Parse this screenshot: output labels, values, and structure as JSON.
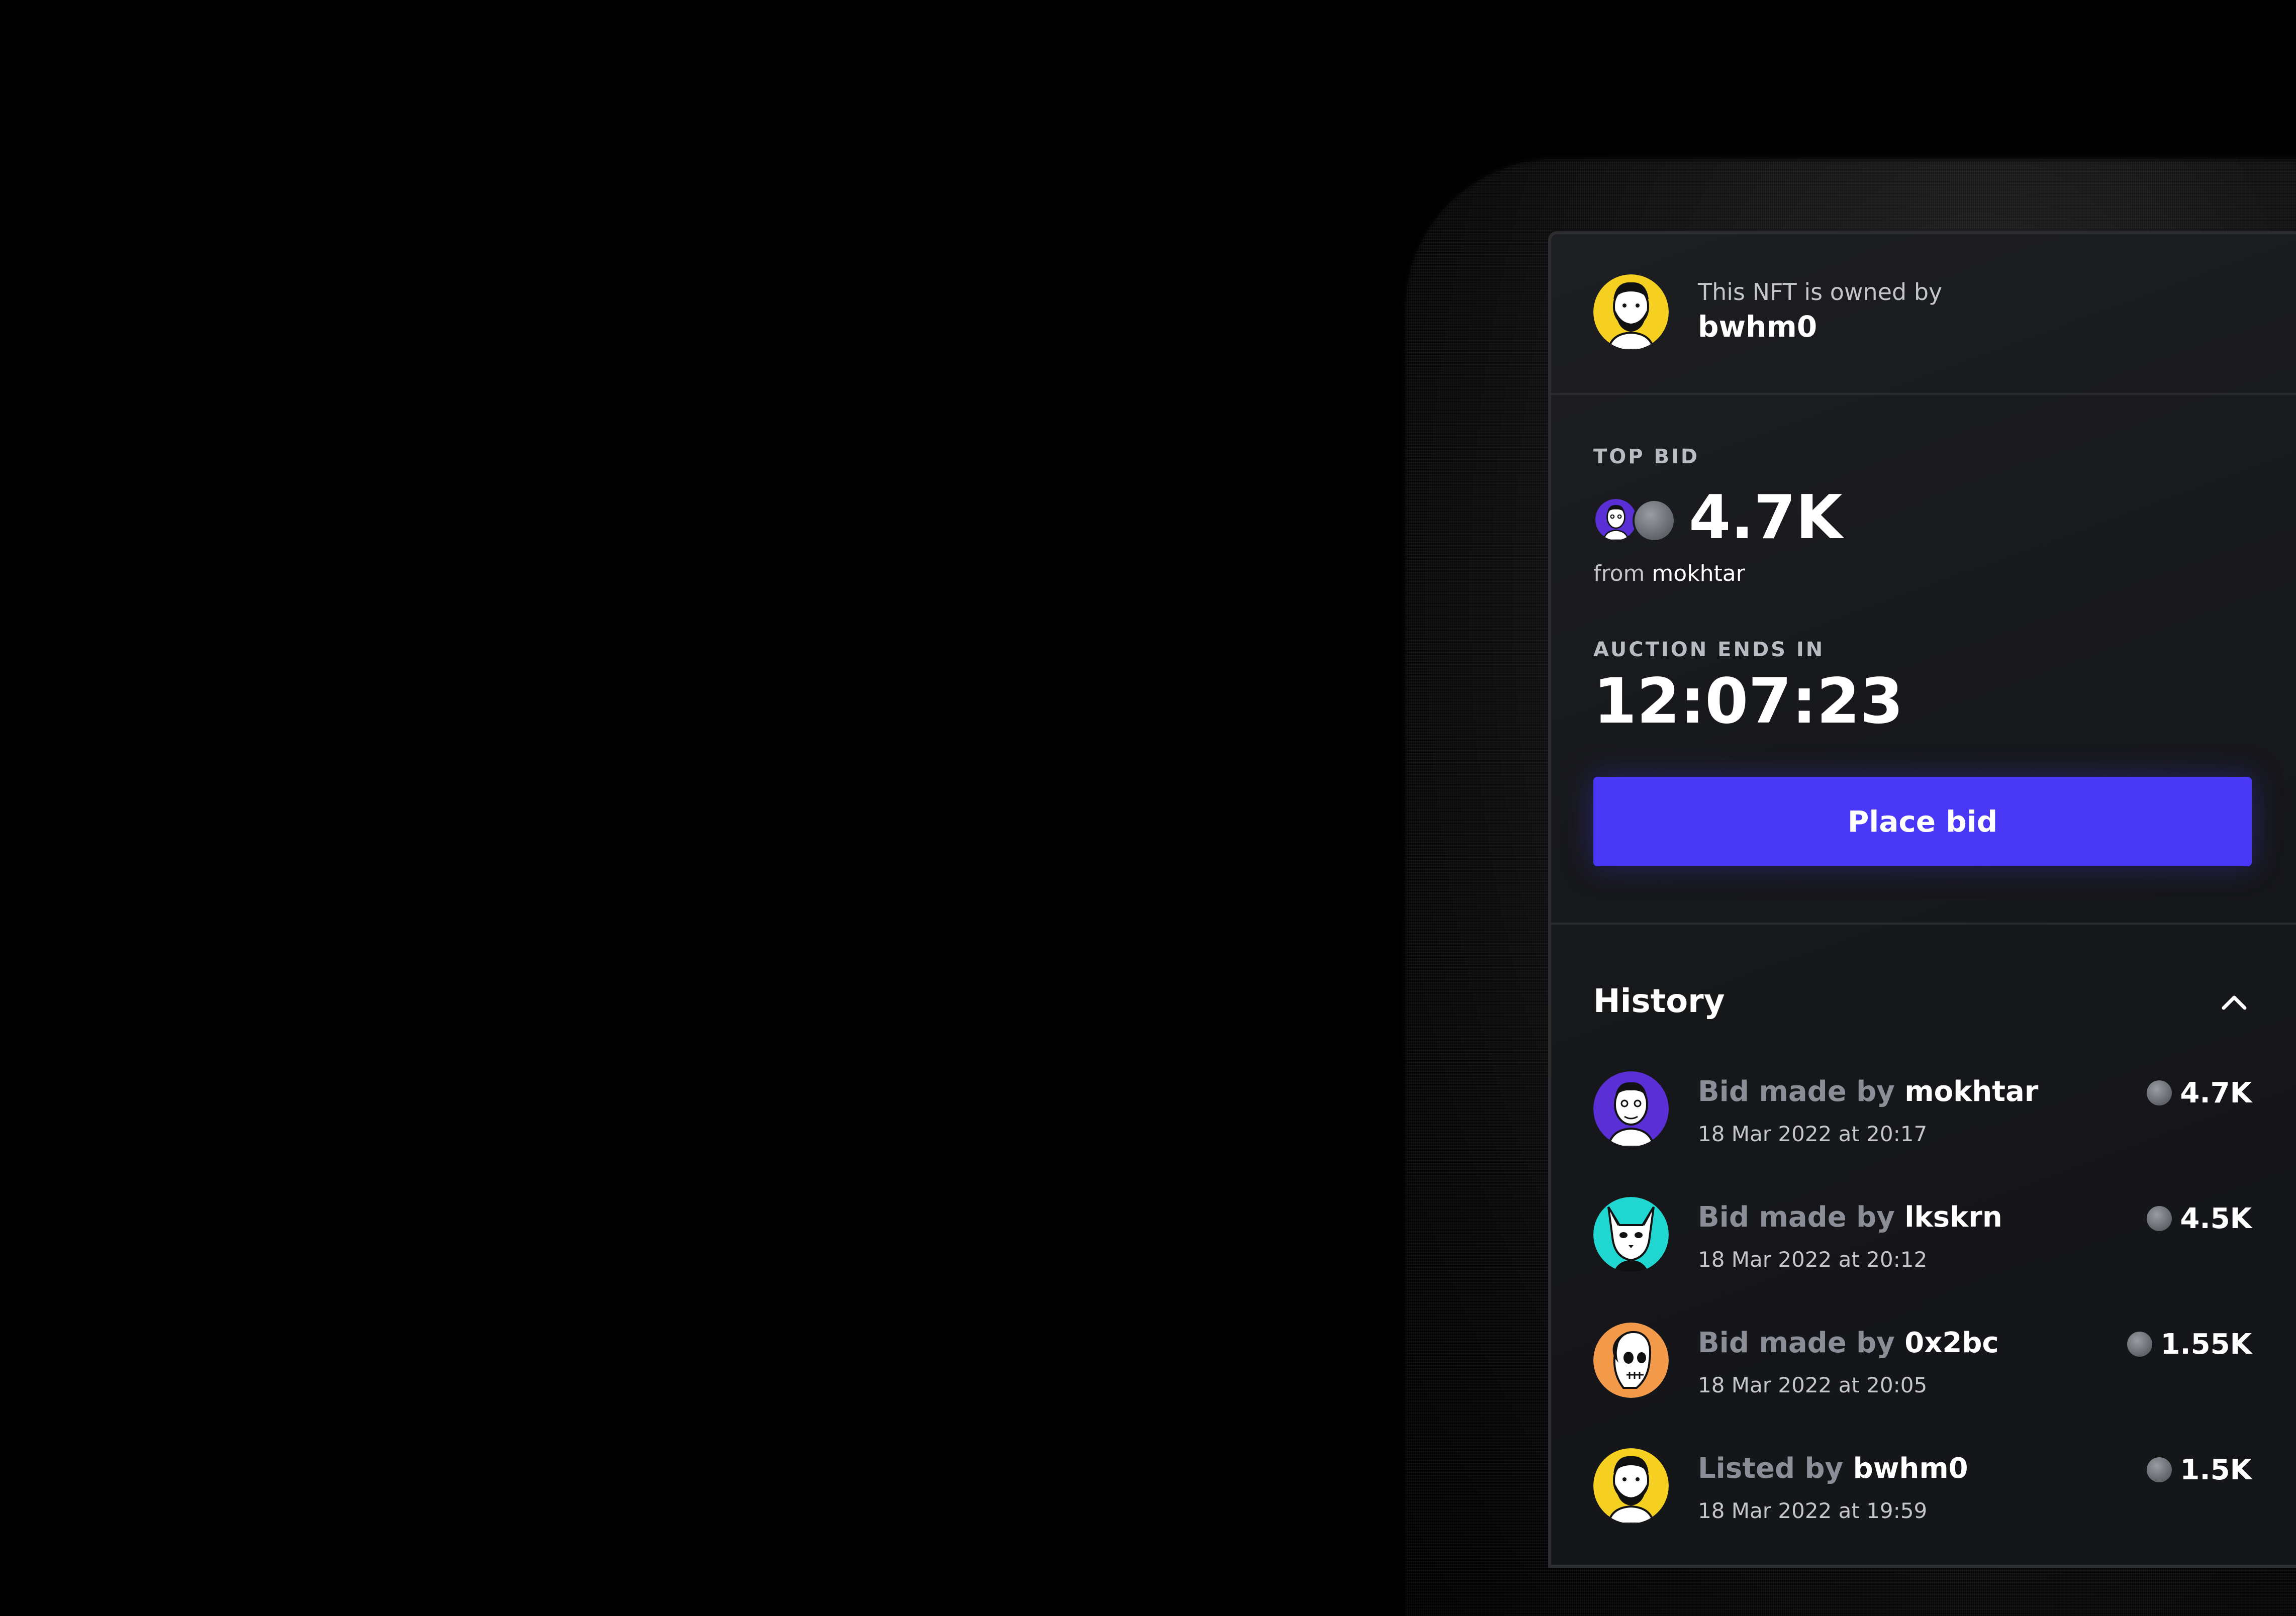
{
  "owner": {
    "label": "This NFT is owned by",
    "name": "bwhm0",
    "avatar_icon": "bearded-man-portrait-icon",
    "avatar_color": "#f5d020"
  },
  "top_bid": {
    "label": "TOP BID",
    "value": "4.7K",
    "from_prefix": "from",
    "from_name": "mokhtar",
    "bidder_avatar_color": "#5a2fd6",
    "currency_icon": "coin-icon"
  },
  "auction": {
    "label": "AUCTION ENDS IN",
    "time": "12:07:23"
  },
  "place_bid": {
    "label": "Place bid",
    "color": "#4938f5"
  },
  "history": {
    "title": "History",
    "toggle_icon": "chevron-up-icon",
    "items": [
      {
        "action": "Bid made by",
        "name": "mokhtar",
        "date": "18 Mar 2022 at 20:17",
        "amount": "4.7K",
        "avatar_color": "#5a2fd6",
        "avatar_icon": "man-portrait-icon"
      },
      {
        "action": "Bid made by",
        "name": "lkskrn",
        "date": "18 Mar 2022 at 20:12",
        "amount": "4.5K",
        "avatar_color": "#1fd6d0",
        "avatar_icon": "cat-portrait-icon"
      },
      {
        "action": "Bid made by",
        "name": "0x2bc",
        "date": "18 Mar 2022 at 20:05",
        "amount": "1.55K",
        "avatar_color": "#f2994a",
        "avatar_icon": "skull-portrait-icon"
      },
      {
        "action": "Listed by",
        "name": "bwhm0",
        "date": "18 Mar 2022 at 19:59",
        "amount": "1.5K",
        "avatar_color": "#f5d020",
        "avatar_icon": "bearded-man-portrait-icon"
      }
    ]
  }
}
